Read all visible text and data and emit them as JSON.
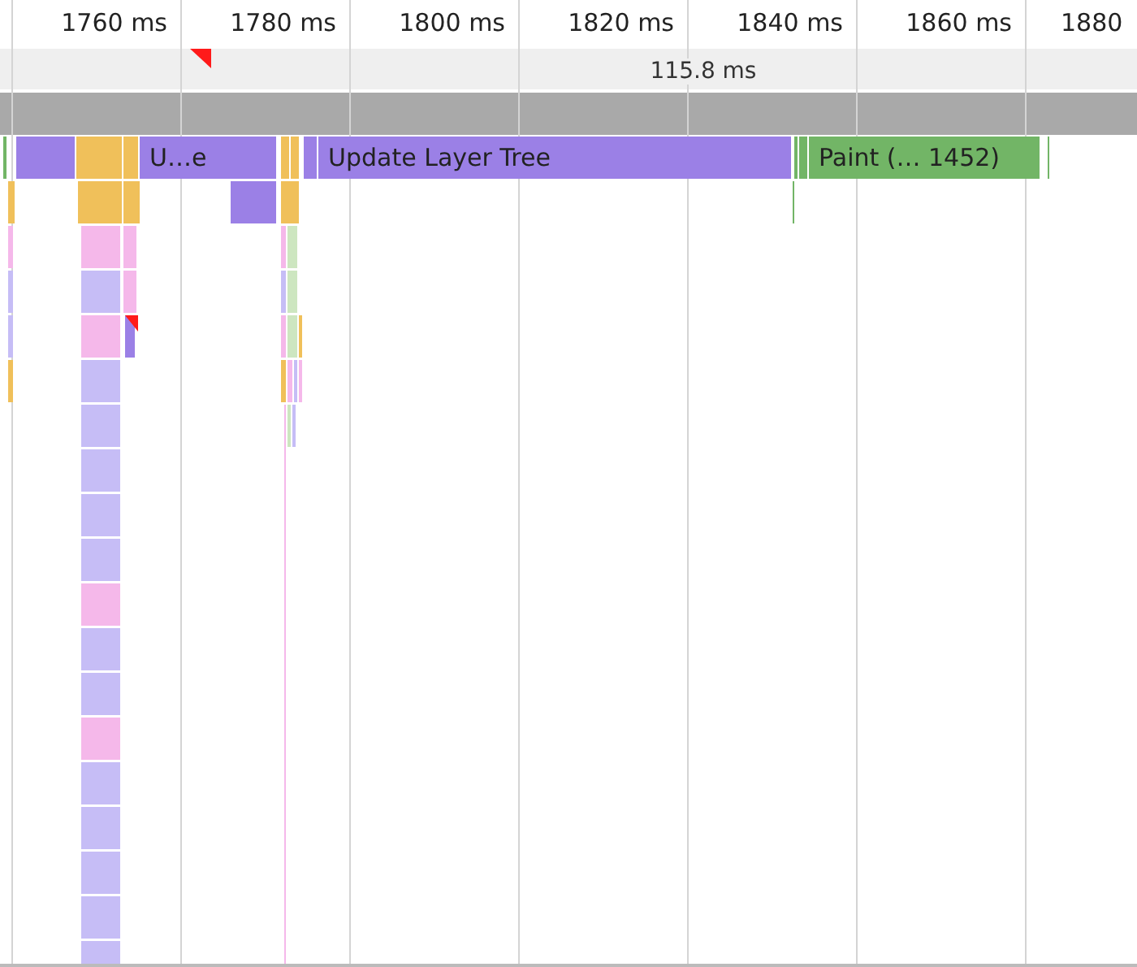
{
  "ruler": {
    "ticks": [
      "1760 ms",
      "1780 ms",
      "1800 ms",
      "1820 ms",
      "1840 ms",
      "1860 ms",
      "1880"
    ]
  },
  "selection": {
    "duration": "115.8 ms"
  },
  "events": [
    {
      "label": "U…e",
      "kind": "rendering"
    },
    {
      "label": "Update Layer Tree",
      "kind": "rendering"
    },
    {
      "label": "Paint (… 1452)",
      "kind": "painting"
    }
  ]
}
